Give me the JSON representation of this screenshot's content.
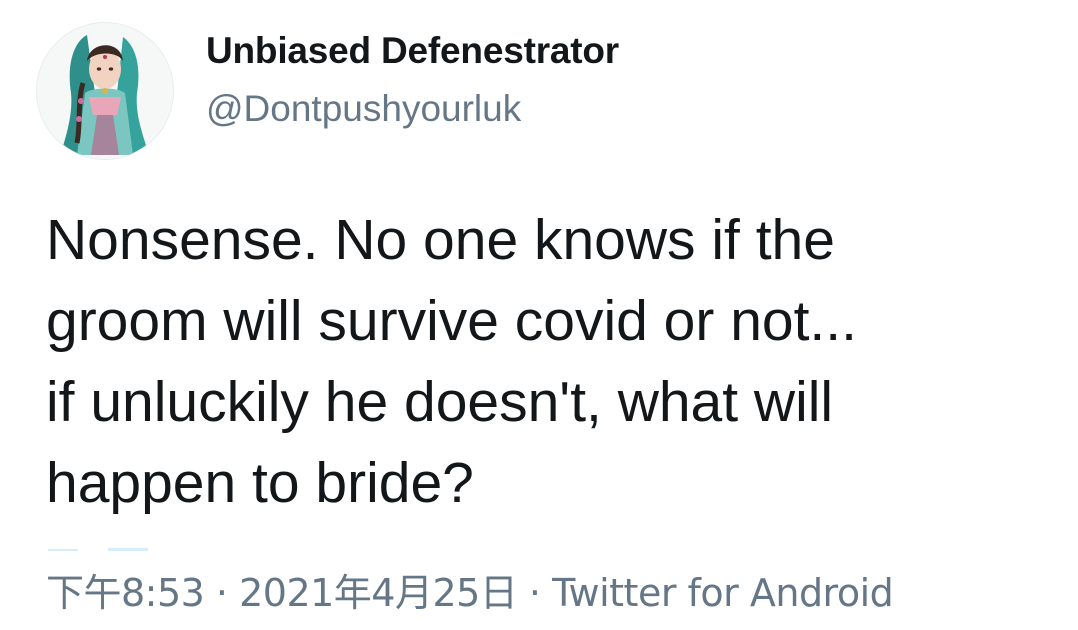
{
  "user": {
    "display_name": "Unbiased Defenestrator",
    "handle": "@Dontpushyourluk",
    "avatar_icon": "illustrated-woman-avatar"
  },
  "tweet": {
    "text": "Nonsense. No one knows if the\ngroom will survive covid or not...\nif unluckily he doesn't, what will\nhappen to bride?"
  },
  "meta": {
    "time": "下午8:53",
    "separator": " · ",
    "date": "2021年4月25日",
    "source": "Twitter for Android"
  },
  "colors": {
    "primary_text": "#14171a",
    "secondary_text": "#657786",
    "background": "#ffffff"
  }
}
